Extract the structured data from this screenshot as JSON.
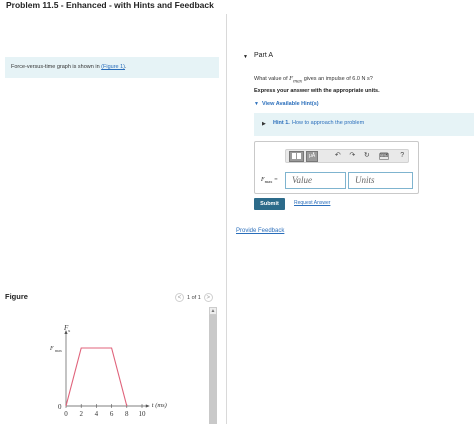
{
  "header": {
    "title": "Problem 11.5 - Enhanced - with Hints and Feedback"
  },
  "intro": {
    "text": "Force-versus-time graph is shown in ",
    "link": "(Figure 1)",
    "after": "."
  },
  "figure": {
    "heading": "Figure",
    "pager": {
      "prev": "<",
      "count": "1 of 1",
      "next": ">"
    }
  },
  "part": {
    "toggle": "▼",
    "label": "Part A",
    "question_pre": "What value of ",
    "question_var": "F",
    "question_sub": "max",
    "question_post": " gives an impulse of 6.0 N s?",
    "instruction": "Express your answer with the appropriate units.",
    "hints_link": "View Available Hint(s)",
    "hint_bold": "Hint 1.",
    "hint_text": "How to approach the problem"
  },
  "answer": {
    "var": "F",
    "sub": "max",
    "eq": " =",
    "value_placeholder": "Value",
    "units_placeholder": "Units",
    "tools": {
      "mu": "μÅ",
      "undo": "↶",
      "redo": "↷",
      "reset": "↻",
      "keyboard": "⌨",
      "help": "?"
    }
  },
  "actions": {
    "submit": "Submit",
    "request": "Request Answer",
    "feedback": "Provide Feedback"
  },
  "chart_data": {
    "type": "line",
    "x": [
      0,
      2,
      4,
      6,
      8,
      10
    ],
    "series": [
      {
        "x": [
          0,
          2,
          6,
          8
        ],
        "y": [
          0,
          1,
          1,
          0
        ]
      }
    ],
    "xticks": [
      "0",
      "2",
      "4",
      "6",
      "8",
      "10"
    ],
    "xlabel": "t (ms)",
    "ylabel": "F",
    "ylabel_sub": "x",
    "ytick_label": "F",
    "ytick_sub": "max",
    "origin_label": "0",
    "xlim": [
      0,
      10.5
    ],
    "ylim": [
      0,
      1.5
    ],
    "line_color": "#e0637b"
  }
}
